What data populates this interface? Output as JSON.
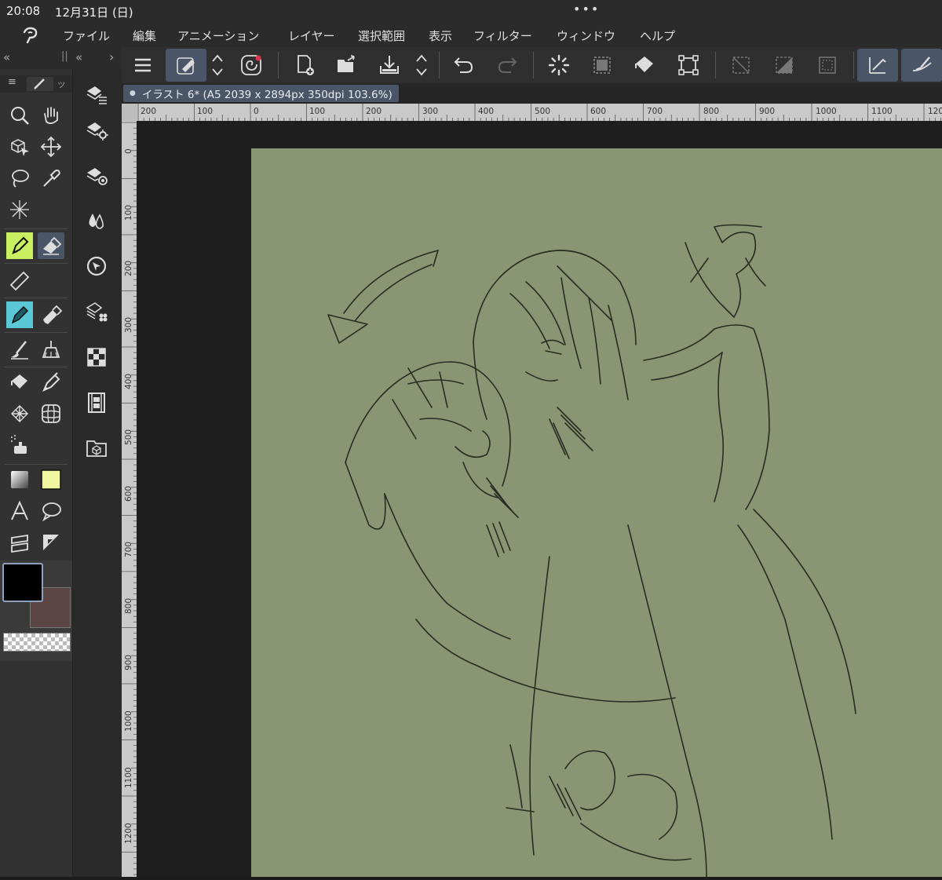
{
  "status_bar": {
    "time": "20:08",
    "date": "12月31日 (日)",
    "dots": "•••"
  },
  "menu": {
    "items": [
      "ファイル",
      "編集",
      "アニメーション",
      "レイヤー",
      "選択範囲",
      "表示",
      "フィルター",
      "ウィンドウ",
      "ヘルプ"
    ]
  },
  "left_header": {
    "collapse_left": "«",
    "grip": "||",
    "collapse_right": "«",
    "expand": "›"
  },
  "palette_tabs": {
    "menu": "≡",
    "tab_label": "ッ"
  },
  "document": {
    "tab_title": "イラスト 6* (A5 2039 x 2894px 350dpi 103.6%)",
    "modified_dot": "●"
  },
  "ruler": {
    "h_labels": [
      "200",
      "100",
      "0",
      "100",
      "200",
      "300",
      "400",
      "500",
      "600",
      "700",
      "800",
      "900",
      "1000",
      "1100",
      "120"
    ],
    "v_labels": [
      "0",
      "100",
      "200",
      "300",
      "400",
      "500",
      "600",
      "700",
      "800",
      "900",
      "1000",
      "1100",
      "1200"
    ]
  },
  "colors": {
    "main_color": "#000000",
    "sub_color": "#5a4444",
    "paper": "#8a9574",
    "accent": "#4a5568",
    "pen_highlight": "#c8f060",
    "pencil_highlight": "#5bc8d8",
    "swatch_highlight": "#f0f5a0"
  },
  "tools": {
    "column1": [
      "search-icon",
      "hand-icon",
      "object-select-icon",
      "move-icon",
      "lasso-icon",
      "eyedropper-icon",
      "magic-wand-icon",
      "pen-icon",
      "eraser-icon",
      "ruler-icon",
      "pencil-icon",
      "marker-icon",
      "brush-icon",
      "blend-icon",
      "fill-icon",
      "ink-icon",
      "pattern-icon",
      "grid-icon",
      "airbrush-icon",
      "gradient-icon",
      "swatch-icon",
      "text-icon",
      "balloon-icon",
      "frame-icon",
      "perspective-icon"
    ],
    "column2": [
      "layer-properties-icon",
      "layer-settings-icon",
      "material-icon",
      "droplets-icon",
      "navigator-icon",
      "layer-search-icon",
      "color-set-icon",
      "animation-icon",
      "assets-icon"
    ]
  },
  "toolbar": {
    "buttons": [
      "menu-icon",
      "edit-mode-icon",
      "up-down-icon",
      "spiral-icon",
      "new-file-icon",
      "open-file-icon",
      "save-icon",
      "updown-icon",
      "undo-icon",
      "redo-icon",
      "loading-icon",
      "deselect-icon",
      "fill-bucket-icon",
      "transform-icon",
      "crop-icon",
      "invert-selection-icon",
      "selection-border-icon",
      "snap-ruler-icon",
      "snap-brush-icon"
    ]
  }
}
